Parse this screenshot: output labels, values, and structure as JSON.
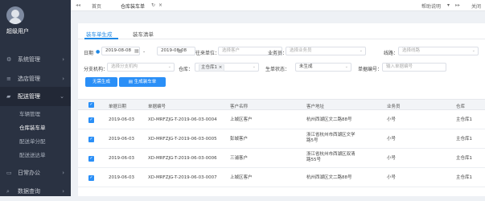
{
  "sidebar": {
    "username": "超级用户",
    "items": [
      {
        "label": "系统管理",
        "icon": "gear-icon"
      },
      {
        "label": "选店管理",
        "icon": "bars-icon"
      },
      {
        "label": "配送管理",
        "icon": "truck-icon"
      },
      {
        "label": "日常办公",
        "icon": "folder-icon"
      },
      {
        "label": "数据查询",
        "icon": "search-icon"
      }
    ],
    "subitems": [
      "车辆管理",
      "仓库装车单",
      "配送单分配",
      "配送送达单"
    ]
  },
  "topbar": {
    "home": "首页",
    "tab": "仓库装车单",
    "help": "帮助说明",
    "close": "关闭"
  },
  "tabs": {
    "gen": "装车单生成",
    "list": "装车清单"
  },
  "filters": {
    "date_label": "日期",
    "date_from": "2019-08-08",
    "date_to": "2019-08-08",
    "org_label": "往来单位：",
    "org_placeholder": "选择客户",
    "sales_label": "业务员：",
    "sales_placeholder": "选择业务员",
    "route_label": "线路：",
    "route_placeholder": "选择线路",
    "branch_label": "分支机构：",
    "branch_placeholder": "选择分支机构",
    "warehouse_label": "仓库：",
    "warehouse_tag": "主仓库1",
    "status_label": "生单状态：",
    "status_value": "未生成",
    "billno_label": "单据编号：",
    "billno_placeholder": "输入单据编号"
  },
  "buttons": {
    "no_generate": "无需生成",
    "generate": "生成装车单"
  },
  "table": {
    "headers": [
      "单据日期",
      "单据编号",
      "客户名称",
      "客户地址",
      "业务员",
      "仓库"
    ],
    "rows": [
      {
        "date": "2019-06-03",
        "no": "XD-MRFZJG-T-2019-06-03-0004",
        "customer": "上城区客户",
        "address": "杭州西湖区文二路88号",
        "sales": "小号",
        "warehouse": "主仓库1"
      },
      {
        "date": "2019-06-03",
        "no": "XD-MRFZJG-T-2019-06-03-0005",
        "customer": "彭城客户",
        "address": "浙江省杭州市西湖区文学路5号",
        "sales": "小号",
        "warehouse": "主仓库1"
      },
      {
        "date": "2019-06-03",
        "no": "XD-MRFZJG-T-2019-06-03-0006",
        "customer": "三浦客户",
        "address": "浙江省杭州市西湖区双清路55号",
        "sales": "小号",
        "warehouse": "主仓库1"
      },
      {
        "date": "2019-06-03",
        "no": "XD-MRFZJG-T-2019-06-03-0007",
        "customer": "上城区客户",
        "address": "杭州西湖区文二路88号",
        "sales": "小号",
        "warehouse": "主仓库1"
      }
    ]
  },
  "colors": {
    "accent": "#2a8ff7",
    "sidebar": "#2a3242"
  }
}
